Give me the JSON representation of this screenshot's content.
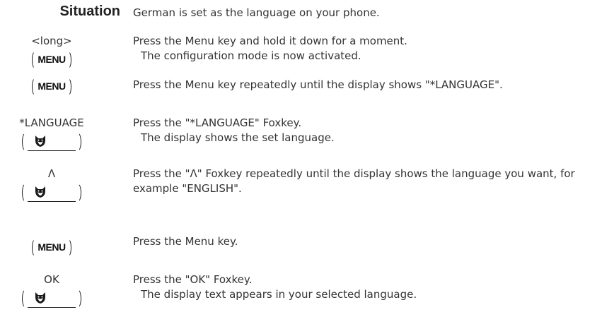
{
  "heading": "Situation",
  "intro": "German is set as the language on your phone.",
  "steps": [
    {
      "key_label": "<long>",
      "key": "MENU",
      "instruction": "Press the Menu key and hold it down for a moment.",
      "result": "The configuration mode is now activated."
    },
    {
      "key_label": "",
      "key": "MENU",
      "instruction": "Press the Menu key repeatedly until the display shows \"*LANGUAGE\".",
      "result": ""
    },
    {
      "key_label": "*LANGUAGE",
      "key": "foxkey",
      "instruction": "Press the \"*LANGUAGE\" Foxkey.",
      "result": "The display shows the set language."
    },
    {
      "key_label": "Λ",
      "key": "foxkey",
      "instruction": "Press the \"Λ\" Foxkey repeatedly until the display shows the language you want, for example \"ENGLISH\".",
      "result": ""
    },
    {
      "key_label": "",
      "key": "MENU",
      "instruction": "Press the Menu key.",
      "result": ""
    },
    {
      "key_label": "OK",
      "key": "foxkey",
      "instruction": "Press the \"OK\" Foxkey.",
      "result": "The display text appears in your selected language."
    }
  ],
  "icons": {
    "menu_key": "menu-key-icon",
    "foxkey": "fox-icon"
  }
}
